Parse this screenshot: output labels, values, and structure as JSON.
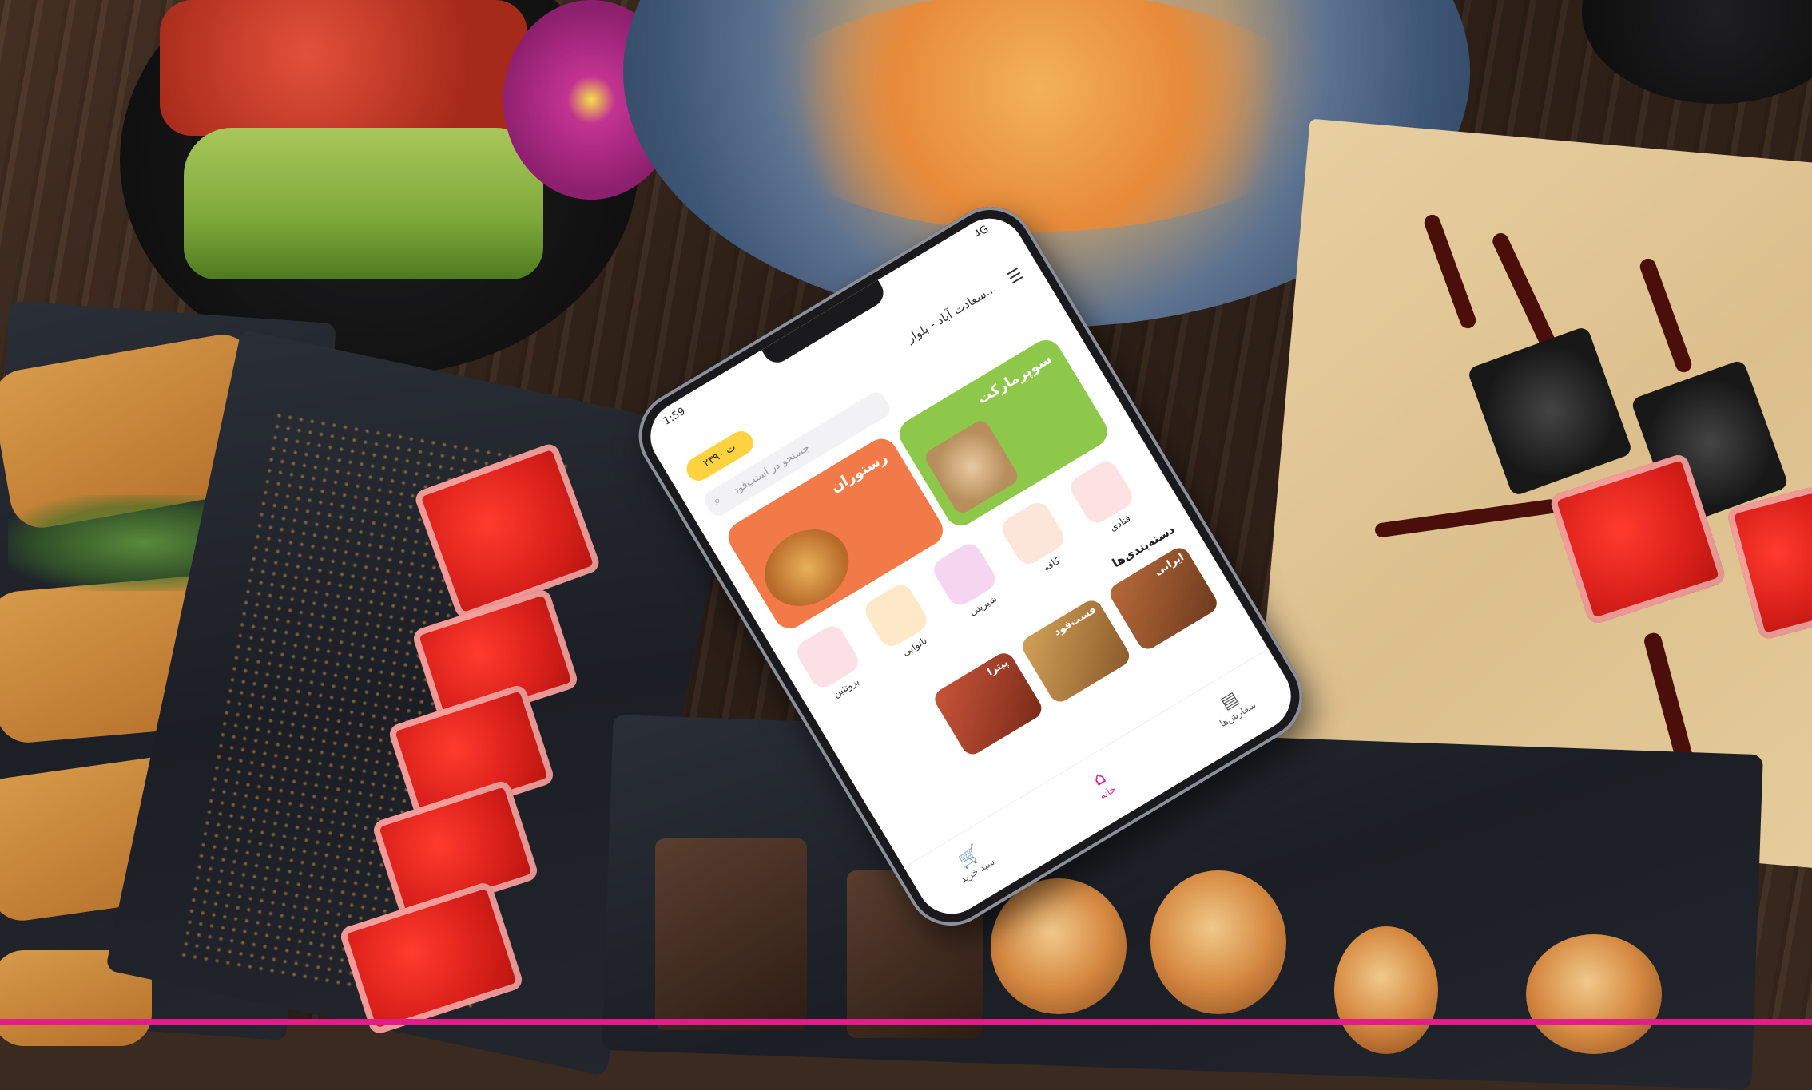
{
  "status_bar": {
    "time": "1:59",
    "signal": "4G"
  },
  "app": {
    "location_label": "سعادت آباد - بلوار...",
    "credit_badge": "۲۳۹۰ ت",
    "search_placeholder": "جستجو در اسنپ‌فود",
    "big_cards": [
      {
        "label": "رستوران",
        "color": "#f27a48"
      },
      {
        "label": "سوپرمارکت",
        "color": "#8ec84a"
      }
    ],
    "tiles": [
      {
        "label": "قنادی",
        "color": "#fde2e4"
      },
      {
        "label": "شیرینی",
        "color": "#f6d5f0"
      },
      {
        "label": "نانوایی",
        "color": "#fde8c7"
      },
      {
        "label": "پروتئین",
        "color": "#fbe1e6"
      },
      {
        "label": "کافه",
        "color": "#fbe6d9"
      }
    ],
    "section_title": "دسته‌بندی‌ها",
    "thumbs": [
      {
        "label": "ایرانی"
      },
      {
        "label": "فست‌فود"
      },
      {
        "label": "پیتزا"
      }
    ],
    "nav": [
      {
        "label": "سفارش‌ها",
        "icon": "receipt-icon"
      },
      {
        "label": "خانه",
        "icon": "home-icon",
        "active": true
      },
      {
        "label": "سبد خرید",
        "icon": "cart-icon"
      }
    ]
  },
  "accent_color": "#e21d8a"
}
